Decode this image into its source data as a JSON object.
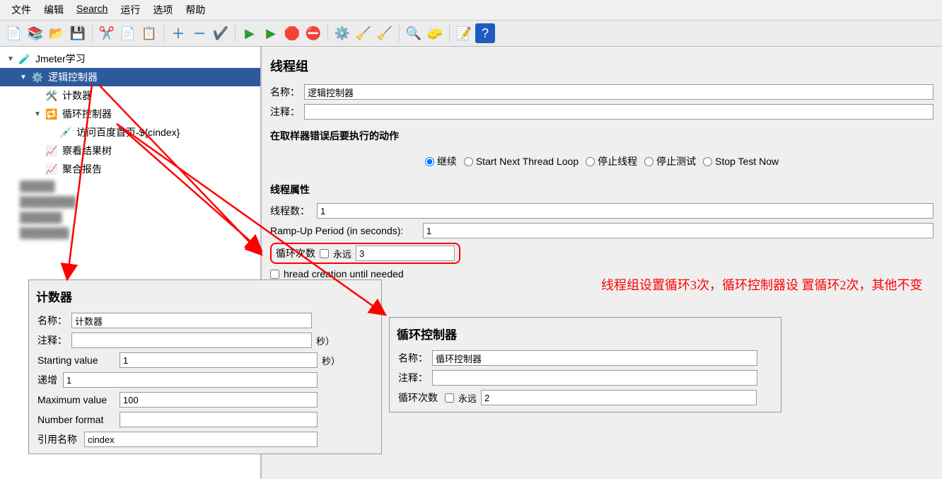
{
  "menu": {
    "file": "文件",
    "edit": "编辑",
    "search": "Search",
    "run": "运行",
    "options": "选项",
    "help": "帮助"
  },
  "tree": {
    "root": "Jmeter学习",
    "logic": "逻辑控制器",
    "counter": "计数器",
    "loop": "循环控制器",
    "visit": "访问百度首页-${cindex}",
    "resultTree": "察看结果树",
    "aggReport": "聚合报告"
  },
  "threadGroup": {
    "title": "线程组",
    "nameLabel": "名称：",
    "nameValue": "逻辑控制器",
    "commentLabel": "注释：",
    "errorLabel": "在取样器错误后要执行的动作",
    "radios": {
      "continue": "继续",
      "startNext": "Start Next Thread Loop",
      "stopThread": "停止线程",
      "stopTest": "停止测试",
      "stopNow": "Stop Test Now"
    },
    "propsLabel": "线程属性",
    "threadsLabel": "线程数：",
    "threadsValue": "1",
    "rampLabel": "Ramp-Up Period (in seconds):",
    "rampValue": "1",
    "loopLabel": "循环次数",
    "foreverLabel": "永远",
    "loopValue": "3",
    "delayLabel": "hread creation until needed"
  },
  "counterPanel": {
    "title": "计数器",
    "nameLabel": "名称：",
    "nameValue": "计数器",
    "commentLabel": "注释：",
    "secSuffix": "秒）",
    "startLabel": "Starting value",
    "startValue": "1",
    "incrLabel": "递增",
    "incrValue": "1",
    "maxLabel": "Maximum value",
    "maxValue": "100",
    "formatLabel": "Number format",
    "refLabel": "引用名称",
    "refValue": "cindex"
  },
  "loopPanel": {
    "title": "循环控制器",
    "nameLabel": "名称：",
    "nameValue": "循环控制器",
    "commentLabel": "注释：",
    "loopLabel": "循环次数",
    "foreverLabel": "永远",
    "loopValue": "2"
  },
  "note": "线程组设置循环3次，循环控制器设\n置循环2次，其他不变"
}
